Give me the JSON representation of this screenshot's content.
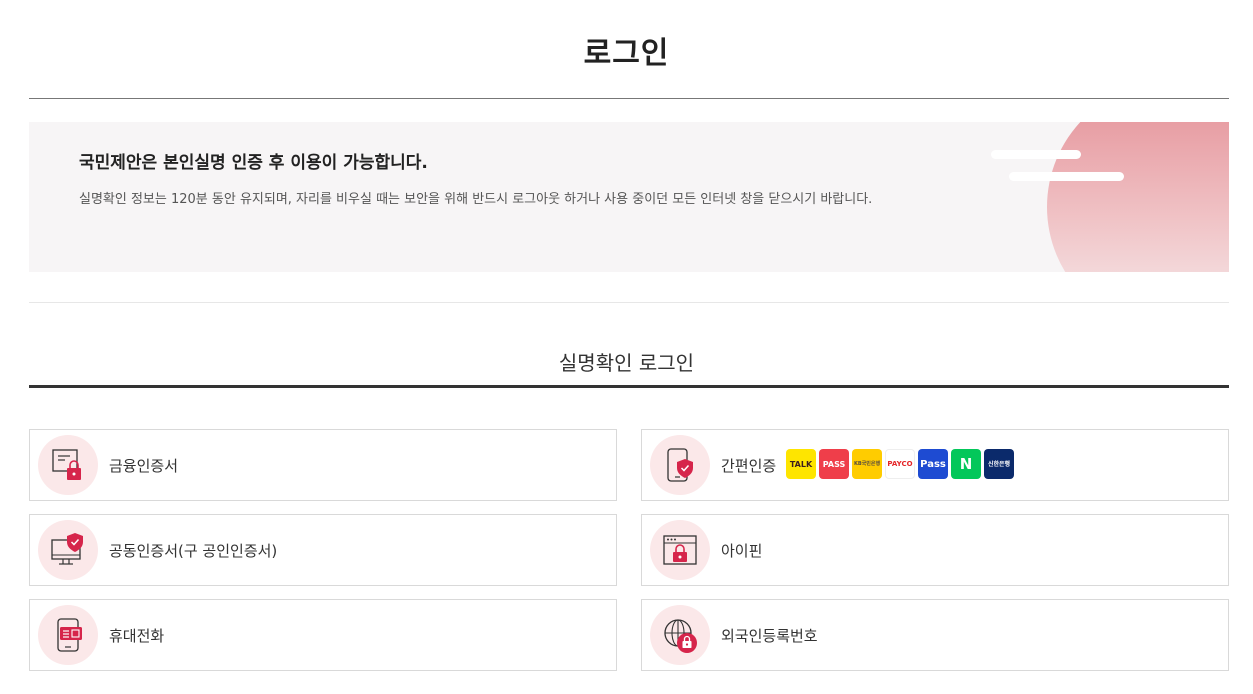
{
  "page": {
    "title": "로그인"
  },
  "notice": {
    "headline": "국민제안은 본인실명 인증 후 이용이 가능합니다.",
    "description": "실명확인 정보는 120분 동안 유지되며, 자리를 비우실 때는 보안을 위해 반드시 로그아웃 하거나 사용 중이던 모든 인터넷 창을 닫으시기 바랍니다."
  },
  "login_section": {
    "title": "실명확인 로그인",
    "options": [
      {
        "label": "금융인증서",
        "icon": "financial-certificate-icon"
      },
      {
        "label": "간편인증",
        "icon": "simple-auth-phone-icon"
      },
      {
        "label": "공동인증서(구 공인인증서)",
        "icon": "joint-certificate-monitor-icon"
      },
      {
        "label": "아이핀",
        "icon": "ipin-browser-icon"
      },
      {
        "label": "휴대전화",
        "icon": "mobile-phone-icon"
      },
      {
        "label": "외국인등록번호",
        "icon": "globe-lock-icon"
      }
    ],
    "providers": [
      {
        "name": "kakao",
        "text": "TALK",
        "bg": "#fee500",
        "fg": "#3c1e1e"
      },
      {
        "name": "pass",
        "text": "PASS",
        "bg": "#ef3e4a",
        "fg": "#ffffff"
      },
      {
        "name": "kb",
        "text": "KB국민은행",
        "bg": "#ffcc00",
        "fg": "#544a3f"
      },
      {
        "name": "payco",
        "text": "PAYCO",
        "bg": "#ffffff",
        "fg": "#e52528"
      },
      {
        "name": "samsung-pass",
        "text": "Pass",
        "bg": "#1e4bd2",
        "fg": "#ffffff"
      },
      {
        "name": "naver",
        "text": "N",
        "bg": "#03c75a",
        "fg": "#ffffff"
      },
      {
        "name": "shinhan",
        "text": "신한은행",
        "bg": "#0b2a6b",
        "fg": "#ffffff"
      }
    ]
  },
  "colors": {
    "accent": "#d6254b",
    "icon_bg": "#fbe8e9",
    "line": "#333333"
  }
}
